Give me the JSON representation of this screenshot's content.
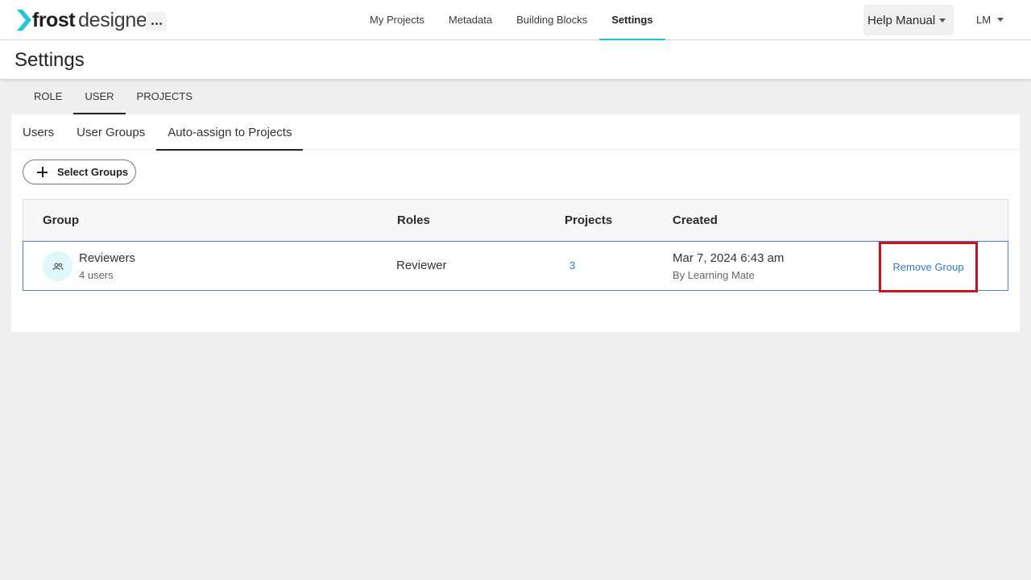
{
  "app": {
    "logo_bold": "frost",
    "logo_light": "designer",
    "brand_color": "#1fc8d8"
  },
  "nav": {
    "items": [
      {
        "label": "My Projects"
      },
      {
        "label": "Metadata"
      },
      {
        "label": "Building Blocks"
      },
      {
        "label": "Settings",
        "active": true
      }
    ]
  },
  "header_right": {
    "help_label": "Help Manual",
    "user_initials": "LM"
  },
  "page": {
    "title": "Settings"
  },
  "tabs": [
    {
      "label": "ROLE"
    },
    {
      "label": "USER",
      "active": true
    },
    {
      "label": "PROJECTS"
    }
  ],
  "subtabs": [
    {
      "label": "Users"
    },
    {
      "label": "User Groups"
    },
    {
      "label": "Auto-assign to Projects",
      "active": true
    }
  ],
  "actions": {
    "select_groups_label": "Select Groups"
  },
  "table": {
    "columns": [
      "Group",
      "Roles",
      "Projects",
      "Created"
    ],
    "rows": [
      {
        "group_name": "Reviewers",
        "group_sub": "4 users",
        "role": "Reviewer",
        "projects": "3",
        "created_date": "Mar 7, 2024 6:43 am",
        "created_by": "By Learning Mate",
        "action_label": "Remove Group"
      }
    ]
  },
  "colors": {
    "link": "#2f7ad1",
    "highlight_border": "#d0111b",
    "row_border": "#4a7fd4"
  }
}
